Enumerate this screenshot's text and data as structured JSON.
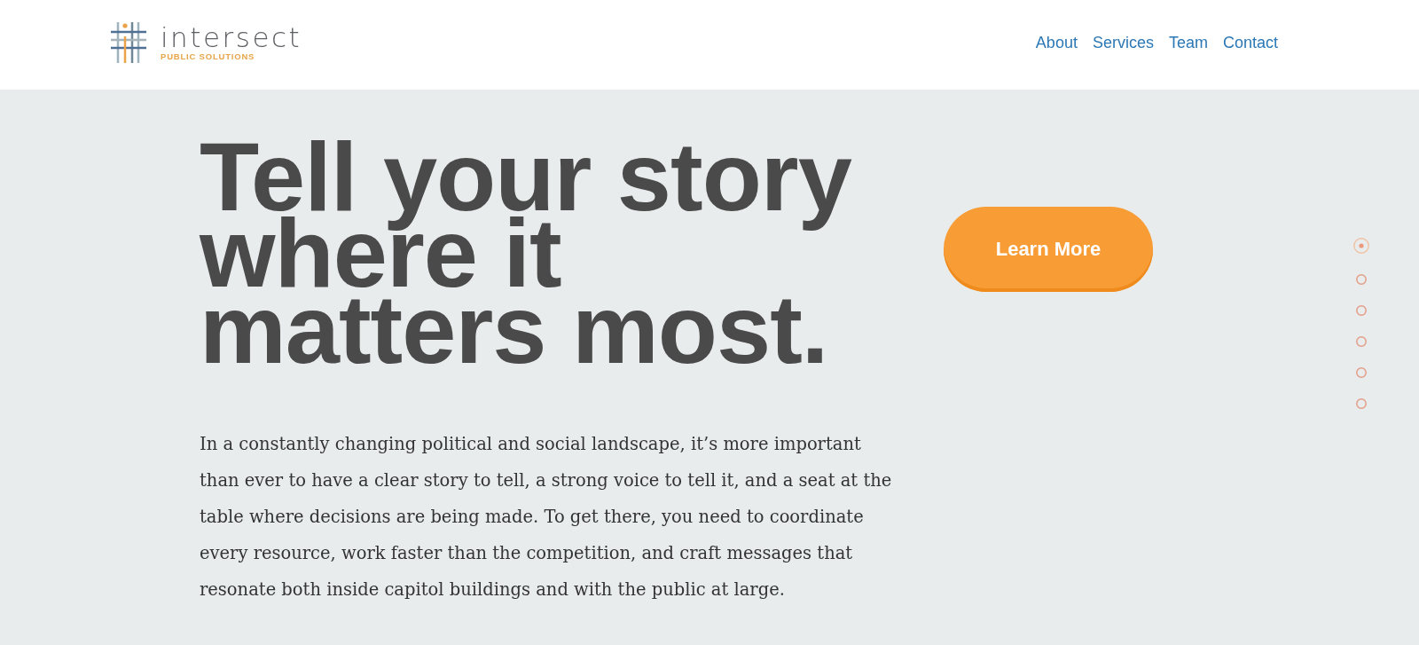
{
  "header": {
    "logo": {
      "name": "intersect",
      "tagline": "PUBLIC SOLUTIONS"
    },
    "nav": [
      {
        "label": "About"
      },
      {
        "label": "Services"
      },
      {
        "label": "Team"
      },
      {
        "label": "Contact"
      }
    ]
  },
  "hero": {
    "headline": "Tell your story where it matters most.",
    "paragraph": "In a constantly changing political and social landscape, it’s more important than ever to have a clear story to tell, a strong voice to tell it, and a seat at the table where decisions are being made. To get there, you need to coordinate every resource, work faster than the competition, and craft messages that resonate both inside capitol buildings and with the public at large.",
    "cta": {
      "label": "Learn More"
    }
  },
  "slide_dots": [
    {
      "selected": true
    },
    {
      "selected": false
    },
    {
      "selected": false
    },
    {
      "selected": false
    },
    {
      "selected": false
    },
    {
      "selected": false
    }
  ]
}
